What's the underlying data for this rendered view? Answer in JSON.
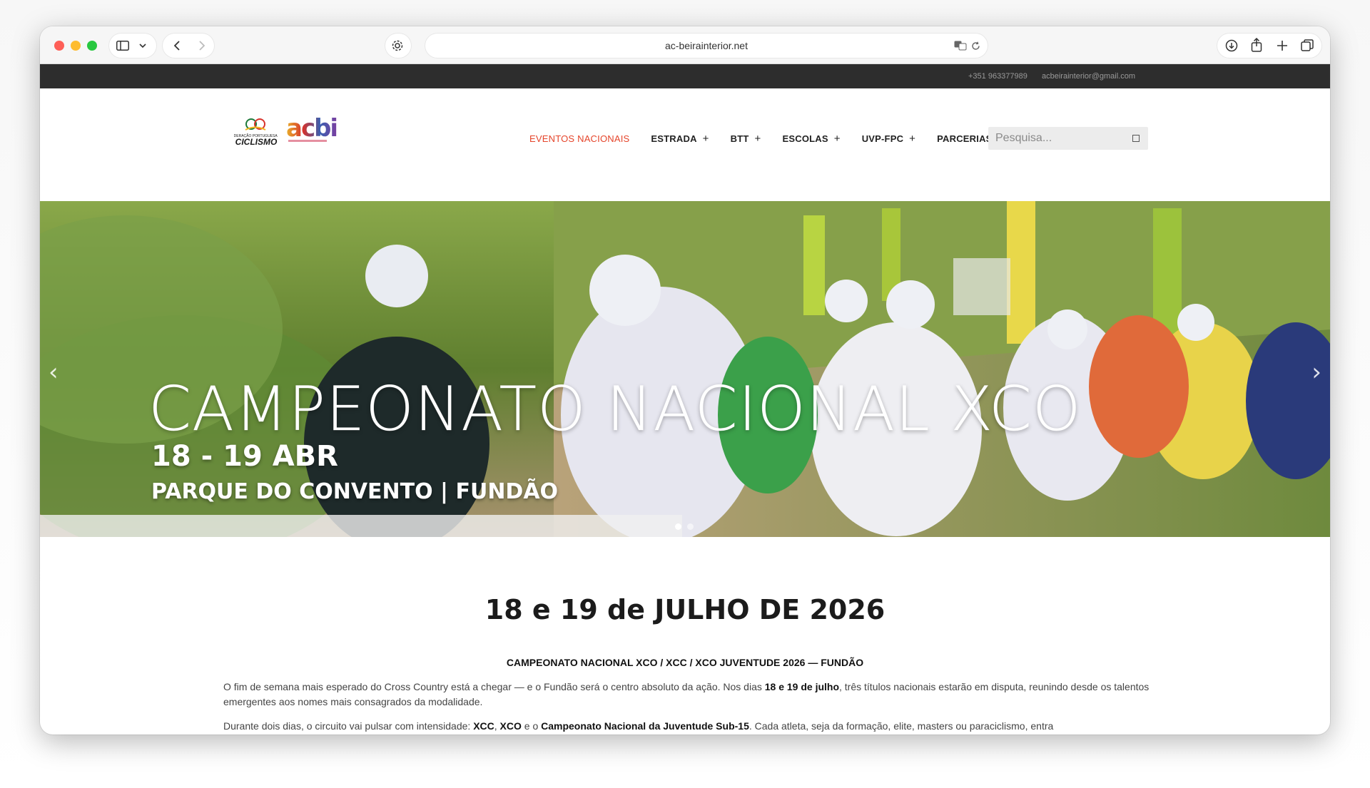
{
  "browser": {
    "url": "ac-beirainterior.net"
  },
  "topbar": {
    "phone": "+351 963377989",
    "email": "acbeirainterior@gmail.com"
  },
  "header": {
    "logo_left_text": "CICLISMO",
    "logo_right_text": "acbi",
    "nav": [
      {
        "label": "EVENTOS NACIONAIS",
        "active": true,
        "has_submenu": false
      },
      {
        "label": "ESTRADA",
        "active": false,
        "has_submenu": true
      },
      {
        "label": "BTT",
        "active": false,
        "has_submenu": true
      },
      {
        "label": "ESCOLAS",
        "active": false,
        "has_submenu": true
      },
      {
        "label": "UVP-FPC",
        "active": false,
        "has_submenu": true
      },
      {
        "label": "PARCERIAS",
        "active": false,
        "has_submenu": false
      }
    ],
    "search_placeholder": "Pesquisa..."
  },
  "hero": {
    "title": "CAMPEONATO NACIONAL XCO",
    "date": "18 - 19 ABR",
    "place": "PARQUE DO CONVENTO | FUNDÃO",
    "slides": 2,
    "active_slide": 1
  },
  "content": {
    "event_title": "18 e 19 de JULHO DE 2026",
    "subtitle": "CAMPEONATO NACIONAL XCO / XCC / XCO JUVENTUDE 2026 — FUNDÃO",
    "p1_a": "O fim de semana mais esperado do Cross Country está a chegar — e o Fundão será o centro absoluto da ação. Nos dias ",
    "p1_b": "18 e 19 de julho",
    "p1_c": ", três títulos nacionais estarão em disputa, reunindo desde os talentos emergentes aos nomes mais consagrados da modalidade.",
    "p2_a": "Durante dois dias, o circuito vai pulsar com intensidade: ",
    "p2_b": "XCC",
    "p2_c": ", ",
    "p2_d": "XCO",
    "p2_e": " e o ",
    "p2_f": "Campeonato Nacional da Juventude Sub-15",
    "p2_g": ". Cada atleta, seja da formação, elite, masters ou paraciclismo, entra"
  },
  "colors": {
    "accent": "#e5452b",
    "topbar": "#2d2d2d"
  }
}
